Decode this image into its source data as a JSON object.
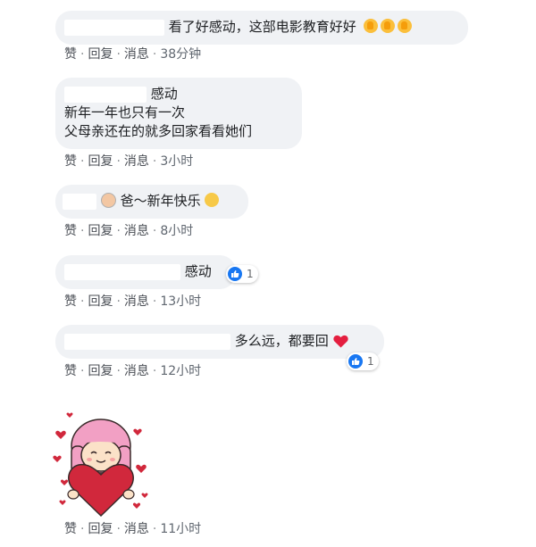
{
  "actions": {
    "like": "赞",
    "reply": "回复",
    "message": "消息",
    "sep": "·"
  },
  "comments": [
    {
      "text": "看了好感动，这部电影教育好好",
      "time": "38分钟"
    },
    {
      "lines": [
        "感动",
        "新年一年也只有一次",
        "父母亲还在的就多回家看看她们"
      ],
      "time": "3小时"
    },
    {
      "text": "爸～新年快乐",
      "time": "8小时"
    },
    {
      "text": "感动",
      "reaction_count": "1",
      "time": "13小时"
    },
    {
      "text": "多么远，都要回",
      "reaction_count": "1",
      "time": "12小时"
    },
    {
      "sticker": "heart-girl-sticker",
      "time": "11小时"
    }
  ],
  "colors": {
    "bubble": "#f0f2f5",
    "like_blue": "#1877f2",
    "heart_red": "#e41e3f"
  }
}
